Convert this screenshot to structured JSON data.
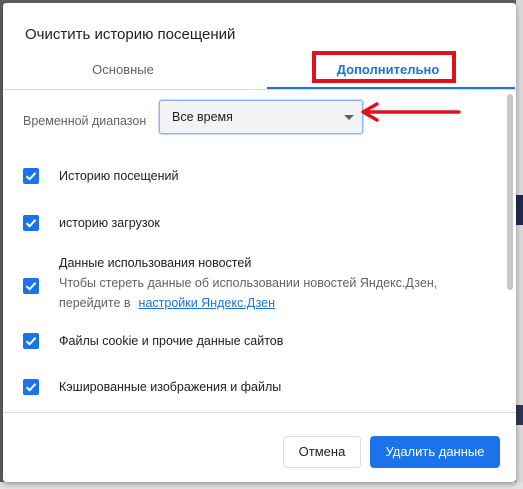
{
  "dialog": {
    "title": "Очистить историю посещений",
    "tabs": [
      {
        "label": "Основные",
        "selected": false
      },
      {
        "label": "Дополнительно",
        "selected": true
      }
    ]
  },
  "time_range": {
    "label": "Временной диапазон",
    "selected": "Все время"
  },
  "items": [
    {
      "label": "Историю посещений",
      "checked": true
    },
    {
      "label": "историю загрузок",
      "checked": true
    },
    {
      "label": "Данные использования новостей",
      "sub_line1": "Чтобы стереть данные об использовании новостей Яндекс.Дзен,",
      "sub_line2": "перейдите в",
      "link": "настройки Яндекс.Дзен",
      "checked": true
    },
    {
      "label": "Файлы cookie и прочие данные сайтов",
      "checked": true
    },
    {
      "label": "Кэшированные изображения и файлы",
      "checked": true
    }
  ],
  "footer": {
    "cancel_label": "Отмена",
    "delete_label": "Удалить данные"
  },
  "colors": {
    "accent": "#1a73e8",
    "annotation": "#e0111b"
  }
}
